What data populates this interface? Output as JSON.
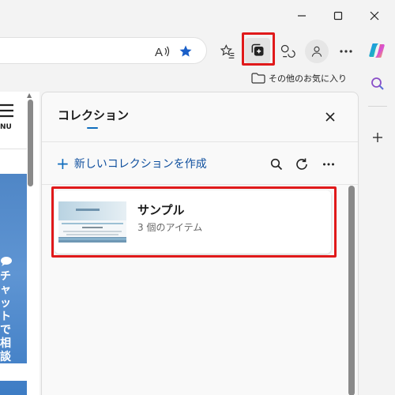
{
  "browser": {
    "favorites_folder_label": "その他のお気に入り"
  },
  "page": {
    "menu_label": "NU",
    "chat_vertical_text": "チャットで相談"
  },
  "panel": {
    "title": "コレクション",
    "new_collection_label": "新しいコレクションを作成",
    "collections": [
      {
        "name": "サンプル",
        "count_text": "3 個のアイテム"
      }
    ]
  },
  "colors": {
    "highlight": "#e0191a",
    "accent": "#0f6cbd"
  }
}
